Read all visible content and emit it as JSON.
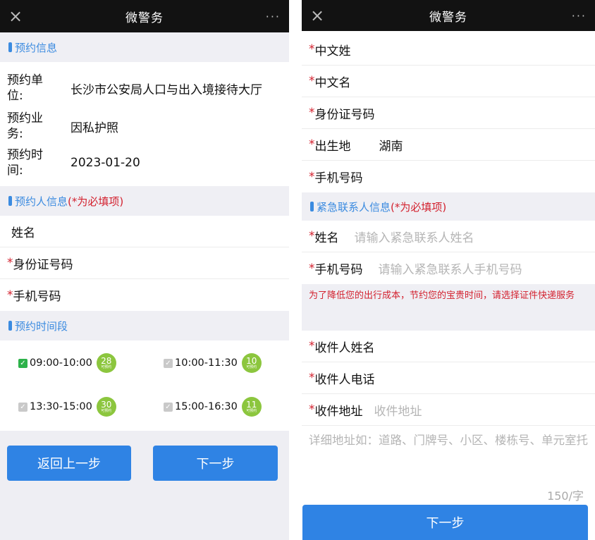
{
  "left": {
    "titlebar": {
      "close": "×",
      "title": "微警务",
      "more": "···"
    },
    "appointment_info": {
      "header": "预约信息",
      "rows": [
        {
          "label_line1": "预约单",
          "label_line2": "位:",
          "value": "长沙市公安局人口与出入境接待大厅"
        },
        {
          "label_line1": "预约业",
          "label_line2": "务:",
          "value": "因私护照"
        },
        {
          "label_line1": "预约时",
          "label_line2": "间:",
          "value": "2023-01-20"
        }
      ]
    },
    "person_info": {
      "header": "预约人信息",
      "required_note": "(*为必填项)",
      "fields": [
        {
          "star": "",
          "label": "姓名"
        },
        {
          "star": "*",
          "label": "身份证号码"
        },
        {
          "star": "*",
          "label": "手机号码"
        }
      ]
    },
    "time_slots": {
      "header": "预约时间段",
      "slots": [
        {
          "time": "09:00-10:00",
          "count": "28",
          "sub": "可预约",
          "checked": true
        },
        {
          "time": "10:00-11:30",
          "count": "10",
          "sub": "可预约",
          "checked": false
        },
        {
          "time": "13:30-15:00",
          "count": "30",
          "sub": "可预约",
          "checked": false
        },
        {
          "time": "15:00-16:30",
          "count": "11",
          "sub": "可预约",
          "checked": false
        }
      ]
    },
    "buttons": {
      "back": "返回上一步",
      "next": "下一步"
    }
  },
  "right": {
    "titlebar": {
      "close": "×",
      "title": "微警务",
      "more": "···"
    },
    "fields": [
      {
        "star": "*",
        "label": "中文姓",
        "value": ""
      },
      {
        "star": "*",
        "label": "中文名",
        "value": ""
      },
      {
        "star": "*",
        "label": "身份证号码",
        "value": ""
      },
      {
        "star": "*",
        "label": "出生地",
        "value": "湖南"
      },
      {
        "star": "*",
        "label": "手机号码",
        "value": ""
      }
    ],
    "emergency": {
      "header": "紧急联系人信息",
      "required_note": "(*为必填项)",
      "fields": [
        {
          "star": "*",
          "label": "姓名",
          "placeholder": "请输入紧急联系人姓名"
        },
        {
          "star": "*",
          "label": "手机号码",
          "placeholder": "请输入紧急联系人手机号码"
        }
      ]
    },
    "notice": "为了降低您的出行成本，节约您的宝贵时间，请选择证件快递服务",
    "delivery": {
      "fields": [
        {
          "star": "*",
          "label": "收件人姓名",
          "placeholder": ""
        },
        {
          "star": "*",
          "label": "收件人电话",
          "placeholder": ""
        },
        {
          "star": "*",
          "label": "收件地址",
          "placeholder": "收件地址"
        }
      ],
      "detail_placeholder": "详细地址如：道路、门牌号、小区、楼栋号、单元室托",
      "counter": "150/字"
    },
    "next_button": "下一步"
  },
  "colors": {
    "accent": "#2f83e4",
    "required": "#d3222f",
    "badge": "#8cc63e",
    "checked": "#2db24a"
  }
}
